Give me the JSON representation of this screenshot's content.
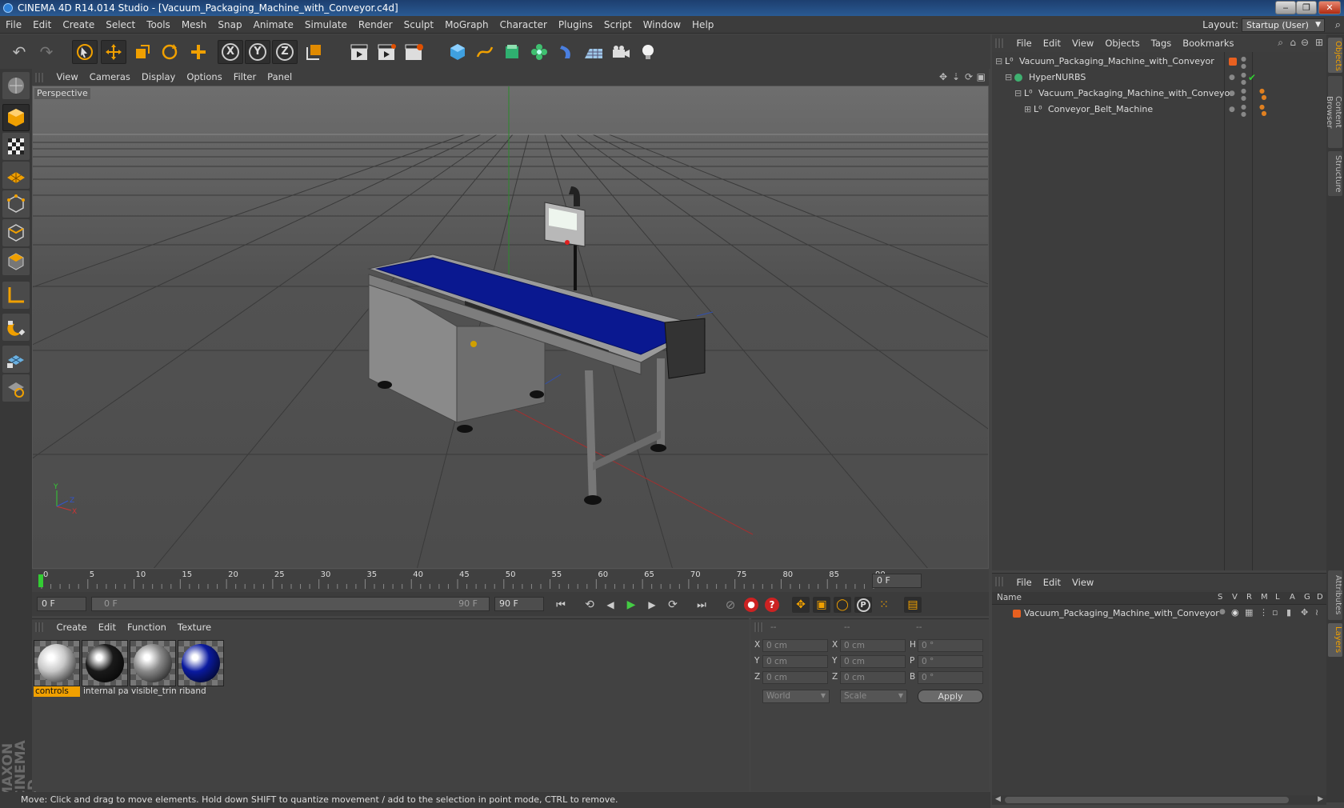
{
  "window": {
    "title": "CINEMA 4D R14.014 Studio - [Vacuum_Packaging_Machine_with_Conveyor.c4d]"
  },
  "menubar": {
    "items": [
      "File",
      "Edit",
      "Create",
      "Select",
      "Tools",
      "Mesh",
      "Snap",
      "Animate",
      "Simulate",
      "Render",
      "Sculpt",
      "MoGraph",
      "Character",
      "Plugins",
      "Script",
      "Window",
      "Help"
    ]
  },
  "layout": {
    "label": "Layout:",
    "value": "Startup (User)"
  },
  "viewport": {
    "menu": [
      "View",
      "Cameras",
      "Display",
      "Options",
      "Filter",
      "Panel"
    ],
    "label": "Perspective"
  },
  "timeline": {
    "ticks": [
      "0",
      "5",
      "10",
      "15",
      "20",
      "25",
      "30",
      "35",
      "40",
      "45",
      "50",
      "55",
      "60",
      "65",
      "70",
      "75",
      "80",
      "85",
      "90"
    ],
    "current_frame": "0 F"
  },
  "transport": {
    "start_field": "0 F",
    "range_start": "0 F",
    "range_end": "90 F",
    "end_field": "90 F"
  },
  "materials": {
    "menu": [
      "Create",
      "Edit",
      "Function",
      "Texture"
    ],
    "items": [
      {
        "name": "controls",
        "color": "#c8c8c8",
        "selected": true
      },
      {
        "name": "internal pa",
        "color": "#1a1a1a",
        "selected": false
      },
      {
        "name": "visible_trim",
        "color": "#8a8a8a",
        "selected": false
      },
      {
        "name": "riband",
        "color": "#0a1aa0",
        "selected": false
      }
    ]
  },
  "coords": {
    "headers": [
      "--",
      "--",
      "--"
    ],
    "rows": [
      {
        "a": "X",
        "av": "0 cm",
        "b": "X",
        "bv": "0 cm",
        "c": "H",
        "cv": "0 °"
      },
      {
        "a": "Y",
        "av": "0 cm",
        "b": "Y",
        "bv": "0 cm",
        "c": "P",
        "cv": "0 °"
      },
      {
        "a": "Z",
        "av": "0 cm",
        "b": "Z",
        "bv": "0 cm",
        "c": "B",
        "cv": "0 °"
      }
    ],
    "space": "World",
    "mode": "Scale",
    "apply": "Apply"
  },
  "objects": {
    "menu": [
      "File",
      "Edit",
      "View",
      "Objects",
      "Tags",
      "Bookmarks"
    ],
    "rows": [
      {
        "name": "Vacuum_Packaging_Machine_with_Conveyor",
        "level": 0
      },
      {
        "name": "HyperNURBS",
        "level": 1
      },
      {
        "name": "Vacuum_Packaging_Machine_with_Conveyor",
        "level": 2
      },
      {
        "name": "Conveyor_Belt_Machine",
        "level": 3
      }
    ]
  },
  "attributes": {
    "menu": [
      "File",
      "Edit",
      "View"
    ],
    "columns": {
      "name": "Name",
      "flags": [
        "S",
        "V",
        "R",
        "M",
        "L",
        "A",
        "G",
        "D"
      ]
    },
    "row": "Vacuum_Packaging_Machine_with_Conveyor"
  },
  "righttabs": [
    "Objects",
    "Content Browser",
    "Structure",
    "Attributes",
    "Layers"
  ],
  "status": "Move: Click and drag to move elements. Hold down SHIFT to quantize movement / add to the selection in point mode, CTRL to remove.",
  "colors": {
    "accent": "#f0a000",
    "belt": "#0a1890",
    "selected_tab": "#f0a000"
  }
}
